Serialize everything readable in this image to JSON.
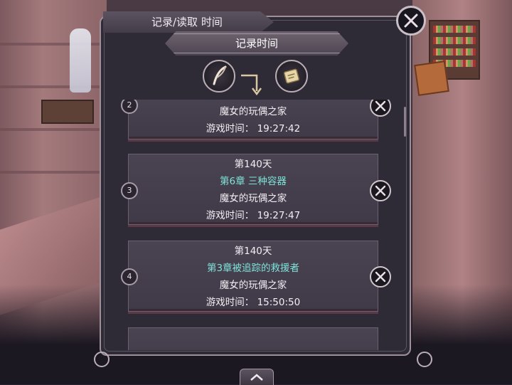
{
  "dialog": {
    "title": "记录/读取 时间",
    "header": "记录时间"
  },
  "mode_icons": [
    "quill-icon",
    "scroll-icon"
  ],
  "slots": [
    {
      "num": "2",
      "lines": [
        "魔女的玩偶之家",
        "游戏时间： 19:27:42"
      ]
    },
    {
      "num": "3",
      "day": "第140天",
      "chapter": "第6章 三种容器",
      "location": "魔女的玩偶之家",
      "time": "游戏时间： 19:27:47"
    },
    {
      "num": "4",
      "day": "第140天",
      "chapter": "第3章被追踪的救援者",
      "location": "魔女的玩偶之家",
      "time": "游戏时间： 15:50:50"
    }
  ],
  "colors": {
    "chapter": "#7fe3d9",
    "panel": "#2e2a36",
    "border": "#9e8f9a"
  }
}
